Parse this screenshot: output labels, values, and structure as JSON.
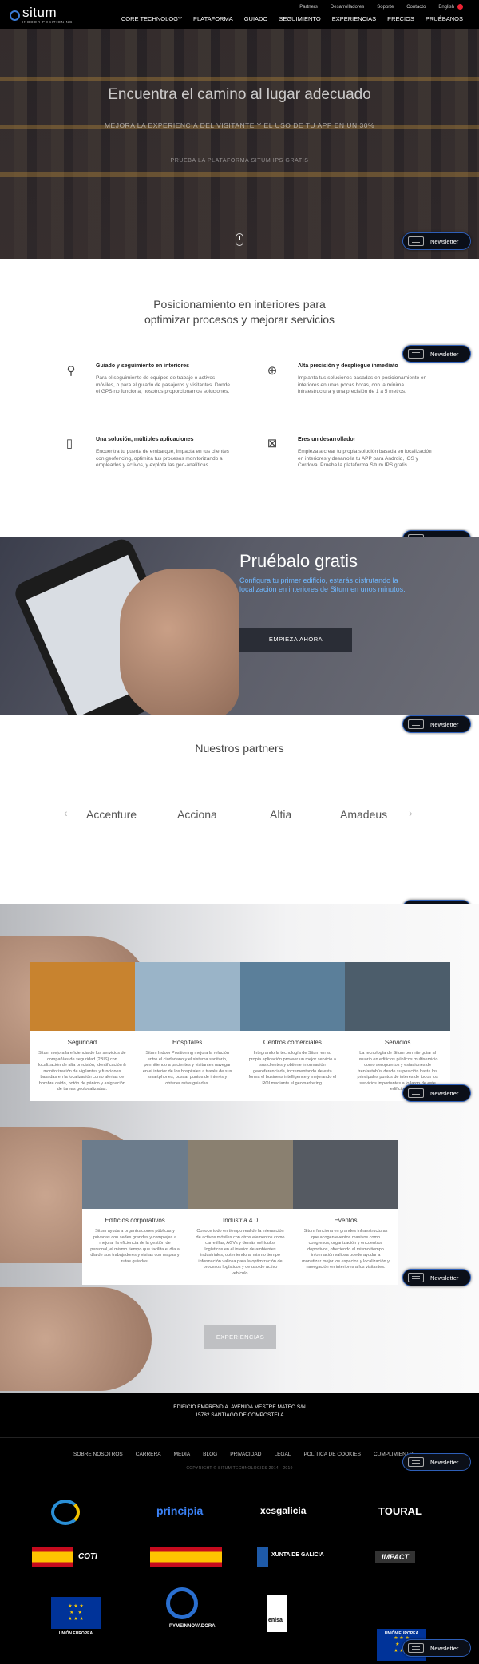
{
  "brand": {
    "name": "situm",
    "tagline": "INDOOR POSITIONING"
  },
  "top_nav": [
    "Partners",
    "Desarrolladores",
    "Soporte",
    "Contacto",
    "English"
  ],
  "main_nav": [
    "CORE TECHNOLOGY",
    "PLATAFORMA",
    "GUIADO",
    "SEGUIMIENTO",
    "EXPERIENCIAS",
    "PRECIOS",
    "PRUÉBANOS"
  ],
  "hero": {
    "title": "Encuentra el camino al lugar adecuado",
    "subtitle": "MEJORA LA EXPERIENCIA DEL VISITANTE Y EL USO DE TU APP EN UN 30%",
    "cta": "PRUEBA LA PLATAFORMA SITUM IPS GRATIS"
  },
  "newsletter_label": "Newsletter",
  "features": {
    "title_line1": "Posicionamiento en interiores para",
    "title_line2": "optimizar procesos y mejorar servicios",
    "items": [
      {
        "icon": "map-pin-icon",
        "title": "Guiado y seguimiento en interiores",
        "text": "Para el seguimiento de equipos de trabajo o activos móviles, o para el guiado de pasajeros y visitantes. Donde el GPS no funciona, nosotros proporcionamos soluciones."
      },
      {
        "icon": "crosshair-icon",
        "title": "Alta precisión y despliegue inmediato",
        "text": "Implanta tus soluciones basadas en posicionamiento en interiores en unas pocas horas, con la mínima infraestructura y una precisión de 1 a 5 metros."
      },
      {
        "icon": "devices-icon",
        "title": "Una solución, múltiples aplicaciones",
        "text": "Encuentra tu puerta de embarque, impacta en tus clientes con geofencing, optimiza tus procesos monitorizando a empleados y activos, y explota las geo-analíticas."
      },
      {
        "icon": "developer-icon",
        "title": "Eres un desarrollador",
        "text": "Empieza a crear tu propia solución basada en localización en interiores y desarrolla tu APP para Android, iOS y Cordova. Prueba la plataforma Situm IPS gratis."
      }
    ]
  },
  "pruebalo": {
    "title": "Pruébalo gratis",
    "subtitle": "Configura tu primer edificio, estarás disfrutando la localización en interiores de Situm en unos minutos.",
    "button": "EMPIEZA AHORA"
  },
  "partners": {
    "title": "Nuestros partners",
    "items": [
      "Accenture",
      "Acciona",
      "Altia",
      "Amadeus"
    ]
  },
  "experiences": {
    "row1": [
      {
        "title": "Seguridad",
        "text": "Situm mejora la eficiencia de los servicios de compañías de seguridad (2BIS) con localización de alta precisión, identificación & monitorización de vigilantes y funciones basadas en la localización como alertas de hombre caído, botón de pánico y asignación de tareas geolocalizadas.",
        "color": "#c8832f"
      },
      {
        "title": "Hospitales",
        "text": "Situm Indoor Positioning mejora la relación entre el ciudadano y el sistema sanitario, permitiendo a pacientes y visitantes navegar en el interior de los hospitales a través de sus smartphones, buscar puntos de interés y obtener rutas guiadas.",
        "color": "#9ab4c8"
      },
      {
        "title": "Centros comerciales",
        "text": "Integrando la tecnología de Situm en su propia aplicación proveer un mejor servicio a sus clientes y obtiene información georeferenciada, incrementando de esta forma el business intelligence y mejorando el ROI mediante el geomarketing.",
        "color": "#5b7f9a"
      },
      {
        "title": "Servicios",
        "text": "La tecnología de Situm permite guiar al usuario en edificios públicos multiservicio como aeropuertos y estaciones de tren/autobús desde su posición hasta los principales puntos de interés de todos los servicios importantes a lo largo de este edificio.",
        "color": "#4c5d6b"
      }
    ],
    "row2": [
      {
        "title": "Edificios corporativos",
        "text": "Situm ayuda a organizaciones públicas y privadas con sedes grandes y complejas a mejorar la eficiencia de la gestión de personal, el mismo tiempo que facilita el día a día de sus trabajadores y visitas con mapas y rutas guiadas.",
        "color": "#6c7c8c"
      },
      {
        "title": "Industria 4.0",
        "text": "Conoce todo en tiempo real de la interacción de activos móviles con otros elementos como carretillas, AGVs y demás vehículos logísticos en el interior de ambientes industriales, obteniendo al mismo tiempo información valiosa para la optimización de procesos logísticos y de uso de activo vehículo.",
        "color": "#8a8070"
      },
      {
        "title": "Eventos",
        "text": "Situm funciona en grandes infraestructuras que acogen eventos masivos como congresos, organización y encuentros deportivos, ofreciendo al mismo tiempo información valiosa puede ayudar a monetizar mejor los espacios y localización y navegación en interiores a los visitantes.",
        "color": "#555a62"
      }
    ],
    "button": "EXPERIENCIAS"
  },
  "footer": {
    "address_line1": "EDIFICIO EMPRENDIA. AVENIDA MESTRE MATEO S/N",
    "address_line2": "15782 SANTIAGO DE COMPOSTELA",
    "links": [
      "SOBRE NOSOTROS",
      "CARRERA",
      "MEDIA",
      "BLOG",
      "PRIVACIDAD",
      "LEGAL",
      "POLÍTICA DE COOKIES",
      "CUMPLIMIENTO"
    ],
    "copyright": "COPYRIGHT © SITUM TECHNOLOGIES 2014 - 2019",
    "sponsors_row1": [
      "principia",
      "xesgalicia",
      "TOURAL"
    ],
    "sponsors_row2": [
      "COTI",
      "XUNTA DE GALICIA",
      "IMPACT"
    ],
    "sponsors_row3": [
      "UNIÓN EUROPEA",
      "PYMEINNOVADORA",
      "enisa",
      "UNIÓN EUROPEA"
    ]
  }
}
